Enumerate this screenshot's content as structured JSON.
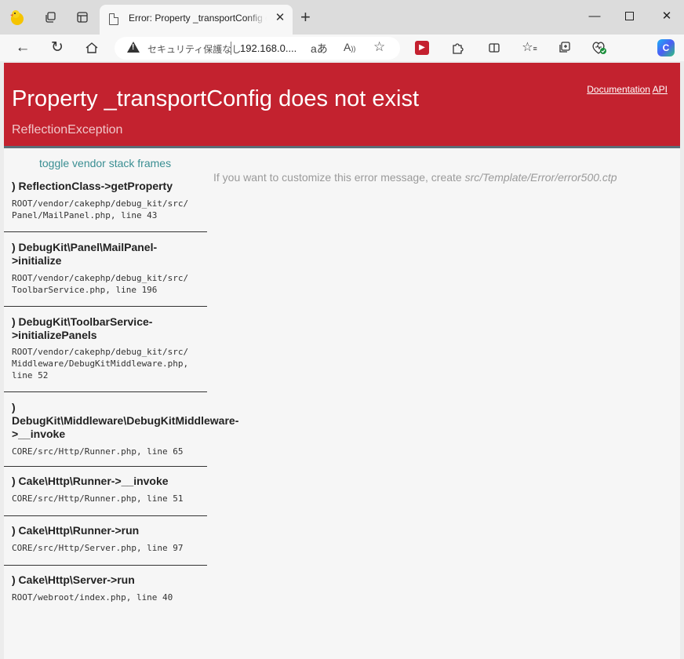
{
  "browser": {
    "tab_title": "Error: Property _transportConfig does not exist",
    "address": {
      "security_label": "セキュリティ保護なし",
      "url": "192.168.0...."
    }
  },
  "header": {
    "title": "Property _transportConfig does not exist",
    "subtitle": "ReflectionException",
    "links": [
      "Documentation",
      "API"
    ]
  },
  "sidebar": {
    "toggle_label": "toggle vendor stack frames",
    "frames": [
      {
        "fn_lines": [
          ") ReflectionClass->getProperty"
        ],
        "file_lines": [
          "ROOT/vendor/cakephp/debug_kit/src/",
          "Panel/MailPanel.php, line 43"
        ]
      },
      {
        "fn_lines": [
          ") DebugKit\\Panel\\MailPanel-",
          ">initialize"
        ],
        "file_lines": [
          "ROOT/vendor/cakephp/debug_kit/src/",
          "ToolbarService.php, line 196"
        ]
      },
      {
        "fn_lines": [
          ") DebugKit\\ToolbarService-",
          ">initializePanels"
        ],
        "file_lines": [
          "ROOT/vendor/cakephp/debug_kit/src/",
          "Middleware/DebugKitMiddleware.php,",
          "line 52"
        ]
      },
      {
        "fn_lines": [
          ")",
          "DebugKit\\Middleware\\DebugKitMiddleware-",
          ">__invoke"
        ],
        "file_lines": [
          "CORE/src/Http/Runner.php, line 65"
        ]
      },
      {
        "fn_lines": [
          ") Cake\\Http\\Runner->__invoke"
        ],
        "file_lines": [
          "CORE/src/Http/Runner.php, line 51"
        ]
      },
      {
        "fn_lines": [
          ") Cake\\Http\\Runner->run"
        ],
        "file_lines": [
          "CORE/src/Http/Server.php, line 97"
        ]
      },
      {
        "fn_lines": [
          ") Cake\\Http\\Server->run"
        ],
        "file_lines": [
          "ROOT/webroot/index.php, line 40"
        ]
      }
    ]
  },
  "main": {
    "customize_text": "If you want to customize this error message, create",
    "customize_path": "src/Template/Error/error500.ctp"
  },
  "colors": {
    "header_bg": "#c3222f",
    "toggle_link": "#3a8e92"
  },
  "icons": [
    "app-logo-icon",
    "workspaces-icon",
    "vertical-tabs-icon",
    "page-icon",
    "close-tab-icon",
    "new-tab-icon",
    "minimize-icon",
    "maximize-icon",
    "window-close-icon",
    "back-icon",
    "refresh-icon",
    "home-icon",
    "warning-icon",
    "read-aloud-icon",
    "text-size-icon",
    "favorite-icon",
    "video-extension-icon",
    "extensions-icon",
    "split-screen-icon",
    "favorites-icon",
    "collections-icon",
    "browser-essentials-icon",
    "copilot-icon"
  ]
}
